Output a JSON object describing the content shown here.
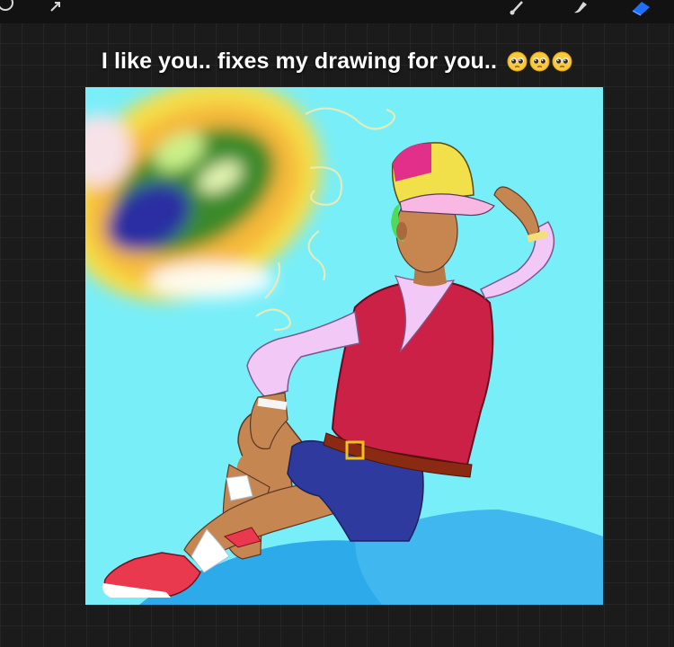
{
  "app": {
    "name": "Procreate",
    "accent_color": "#1f6fff",
    "background_color": "#1b1b1b"
  },
  "toolbar": {
    "left_tools": [
      {
        "icon": "undo-icon"
      },
      {
        "icon": "transform-arrow-icon"
      }
    ],
    "right_tools": [
      {
        "icon": "brush-icon"
      },
      {
        "icon": "smudge-icon"
      },
      {
        "icon": "eraser-icon",
        "active": true
      }
    ]
  },
  "overlay": {
    "caption": "I like you.. fixes my drawing for you..",
    "emojis": [
      "pleading-face-emoji",
      "pleading-face-emoji",
      "pleading-face-emoji"
    ]
  },
  "canvas": {
    "background_color": "#78eef8",
    "artwork": "character-drawing"
  }
}
